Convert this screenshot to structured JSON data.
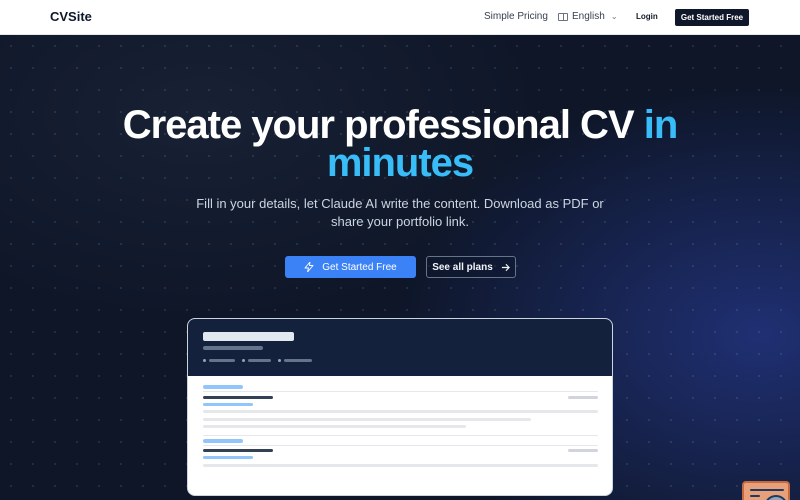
{
  "header": {
    "brand": "CVSite",
    "pricing_label": "Simple Pricing",
    "language_label": "English",
    "login_label": "Login",
    "cta_label": "Get Started Free"
  },
  "hero": {
    "title_main": "Create your professional CV",
    "title_accent_1": "in",
    "title_accent_2": "minutes",
    "subtitle": "Fill in your details, let Claude AI write the content. Download as PDF or share your portfolio link.",
    "primary_button": "Get Started Free",
    "secondary_button": "See all plans"
  },
  "colors": {
    "accent": "#38bdf8",
    "primary_button": "#3b82f6",
    "dark_bg": "#0f172a"
  },
  "icons": {
    "primary_button_icon": "lightning-icon",
    "secondary_button_icon": "arrow-right-icon",
    "language_icon": "language-icon",
    "widget_icon": "help-widget-icon"
  }
}
